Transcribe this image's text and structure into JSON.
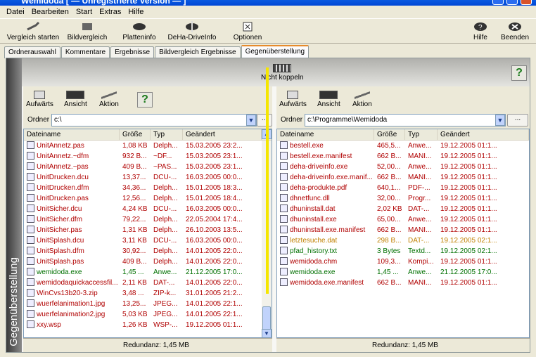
{
  "window": {
    "title": "Wemidoda [ — Unregistrierte Version — ]"
  },
  "menu": [
    "Datei",
    "Bearbeiten",
    "Start",
    "Extras",
    "Hilfe"
  ],
  "toolbar": [
    {
      "label": "Vergleich starten",
      "icon": "check-icon"
    },
    {
      "label": "Bildvergleich",
      "icon": "image-compare-icon"
    },
    {
      "label": "Platteninfo",
      "icon": "disk-icon"
    },
    {
      "label": "DeHa-DriveInfo",
      "icon": "drive-icon"
    },
    {
      "label": "Optionen",
      "icon": "options-icon"
    },
    {
      "label": "Hilfe",
      "icon": "help-icon"
    },
    {
      "label": "Beenden",
      "icon": "exit-icon"
    }
  ],
  "tabs": [
    "Ordnerauswahl",
    "Kommentare",
    "Ergebnisse",
    "Bildvergleich Ergebnisse",
    "Gegenüberstellung"
  ],
  "active_tab": "Gegenüberstellung",
  "side_label": "Gegenüberstellung",
  "couple": {
    "label": "Nicht koppeln"
  },
  "pane_tools": {
    "up": "Aufwärts",
    "view": "Ansicht",
    "action": "Aktion",
    "help": "?"
  },
  "folder_label": "Ordner",
  "browse": "...",
  "columns": [
    "Dateiname",
    "Größe",
    "Typ",
    "Geändert"
  ],
  "colors": {
    "red": "#b00000",
    "green": "#007000",
    "orange": "#c08000",
    "divider": "#f5e600"
  },
  "left": {
    "folder": "c:\\",
    "status": "Redundanz: 1,45 MB",
    "files": [
      {
        "name": "UnitAnnetz.pas",
        "size": "1,08 KB",
        "type": "Delph...",
        "date": "15.03.2005 23:2...",
        "c": "red"
      },
      {
        "name": "UnitAnnetz.~dfm",
        "size": "932 B...",
        "type": "~DF...",
        "date": "15.03.2005 23:1...",
        "c": "red"
      },
      {
        "name": "UnitAnnetz.~pas",
        "size": "409 B...",
        "type": "~PAS...",
        "date": "15.03.2005 23:1...",
        "c": "red"
      },
      {
        "name": "UnitDrucken.dcu",
        "size": "13,37...",
        "type": "DCU-...",
        "date": "16.03.2005 00:0...",
        "c": "red"
      },
      {
        "name": "UnitDrucken.dfm",
        "size": "34,36...",
        "type": "Delph...",
        "date": "15.01.2005 18:3...",
        "c": "red"
      },
      {
        "name": "UnitDrucken.pas",
        "size": "12,56...",
        "type": "Delph...",
        "date": "15.01.2005 18:4...",
        "c": "red"
      },
      {
        "name": "UnitSicher.dcu",
        "size": "4,24 KB",
        "type": "DCU-...",
        "date": "16.03.2005 00:0...",
        "c": "red"
      },
      {
        "name": "UnitSicher.dfm",
        "size": "79,22...",
        "type": "Delph...",
        "date": "22.05.2004 17:4...",
        "c": "red"
      },
      {
        "name": "UnitSicher.pas",
        "size": "1,31 KB",
        "type": "Delph...",
        "date": "26.10.2003 13:5...",
        "c": "red"
      },
      {
        "name": "UnitSplash.dcu",
        "size": "3,11 KB",
        "type": "DCU-...",
        "date": "16.03.2005 00:0...",
        "c": "red"
      },
      {
        "name": "UnitSplash.dfm",
        "size": "30,92...",
        "type": "Delph...",
        "date": "14.01.2005 22:0...",
        "c": "red"
      },
      {
        "name": "UnitSplash.pas",
        "size": "409 B...",
        "type": "Delph...",
        "date": "14.01.2005 22:0...",
        "c": "red"
      },
      {
        "name": "wemidoda.exe",
        "size": "1,45 ...",
        "type": "Anwe...",
        "date": "21.12.2005 17:0...",
        "c": "green"
      },
      {
        "name": "wemidodaquickaccessfil...",
        "size": "2,11 KB",
        "type": "DAT-...",
        "date": "14.01.2005 22:0...",
        "c": "red"
      },
      {
        "name": "WinCvs13b20-3.zip",
        "size": "3,48 ...",
        "type": "ZIP-k...",
        "date": "31.01.2005 21:2...",
        "c": "red"
      },
      {
        "name": "wuerfelanimation1.jpg",
        "size": "13,25...",
        "type": "JPEG...",
        "date": "14.01.2005 22:1...",
        "c": "red"
      },
      {
        "name": "wuerfelanimation2.jpg",
        "size": "5,03 KB",
        "type": "JPEG...",
        "date": "14.01.2005 22:1...",
        "c": "red"
      },
      {
        "name": "xxy.wsp",
        "size": "1,26 KB",
        "type": "WSP-...",
        "date": "19.12.2005 01:1...",
        "c": "red"
      }
    ]
  },
  "right": {
    "folder": "c:\\Programme\\Wemidoda",
    "status": "Redundanz: 1,45 MB",
    "files": [
      {
        "name": "bestell.exe",
        "size": "465,5...",
        "type": "Anwe...",
        "date": "19.12.2005 01:1...",
        "c": "red"
      },
      {
        "name": "bestell.exe.manifest",
        "size": "662 B...",
        "type": "MANI...",
        "date": "19.12.2005 01:1...",
        "c": "red"
      },
      {
        "name": "deha-driveinfo.exe",
        "size": "52,00...",
        "type": "Anwe...",
        "date": "19.12.2005 01:1...",
        "c": "red"
      },
      {
        "name": "deha-driveinfo.exe.manif...",
        "size": "662 B...",
        "type": "MANI...",
        "date": "19.12.2005 01:1...",
        "c": "red"
      },
      {
        "name": "deha-produkte.pdf",
        "size": "640,1...",
        "type": "PDF-...",
        "date": "19.12.2005 01:1...",
        "c": "red"
      },
      {
        "name": "dhnetfunc.dll",
        "size": "32,00...",
        "type": "Progr...",
        "date": "19.12.2005 01:1...",
        "c": "red"
      },
      {
        "name": "dhuninstall.dat",
        "size": "2,02 KB",
        "type": "DAT-...",
        "date": "19.12.2005 01:1...",
        "c": "red"
      },
      {
        "name": "dhuninstall.exe",
        "size": "65,00...",
        "type": "Anwe...",
        "date": "19.12.2005 01:1...",
        "c": "red"
      },
      {
        "name": "dhuninstall.exe.manifest",
        "size": "662 B...",
        "type": "MANI...",
        "date": "19.12.2005 01:1...",
        "c": "red"
      },
      {
        "name": "letztesuche.dat",
        "size": "298 B...",
        "type": "DAT-...",
        "date": "19.12.2005 02:1...",
        "c": "orange"
      },
      {
        "name": "pfad_history.txt",
        "size": "3 Bytes",
        "type": "Textd...",
        "date": "19.12.2005 02:1...",
        "c": "green"
      },
      {
        "name": "wemidoda.chm",
        "size": "109,3...",
        "type": "Kompi...",
        "date": "19.12.2005 01:1...",
        "c": "red"
      },
      {
        "name": "wemidoda.exe",
        "size": "1,45 ...",
        "type": "Anwe...",
        "date": "21.12.2005 17:0...",
        "c": "green"
      },
      {
        "name": "wemidoda.exe.manifest",
        "size": "662 B...",
        "type": "MANI...",
        "date": "19.12.2005 01:1...",
        "c": "red"
      }
    ]
  }
}
